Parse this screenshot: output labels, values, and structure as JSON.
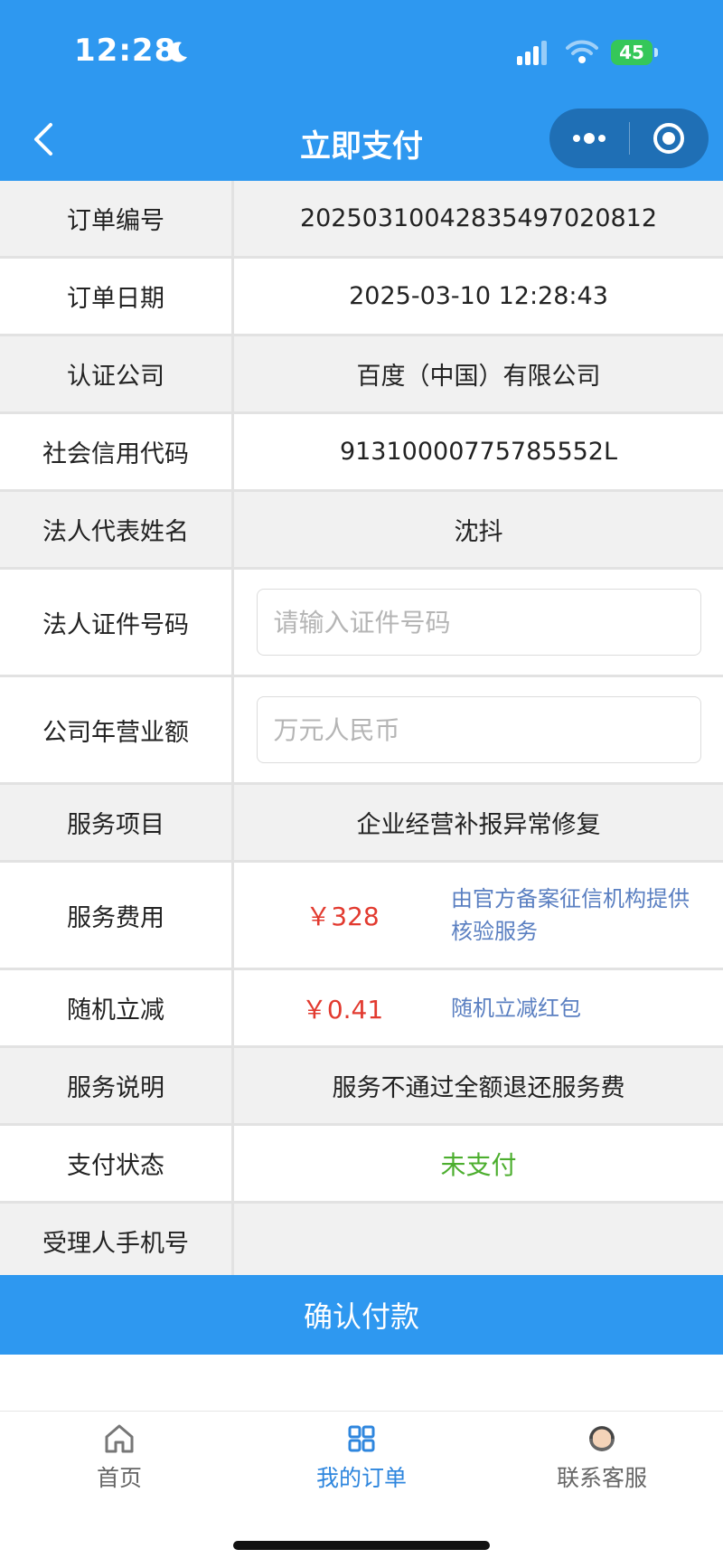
{
  "status_bar": {
    "time": "12:28",
    "battery": "45"
  },
  "nav": {
    "title": "立即支付"
  },
  "rows": [
    {
      "label": "订单编号",
      "value": "20250310042835497020812"
    },
    {
      "label": "订单日期",
      "value": "2025-03-10 12:28:43"
    },
    {
      "label": "认证公司",
      "value": "百度（中国）有限公司"
    },
    {
      "label": "社会信用代码",
      "value": "91310000775785552L"
    },
    {
      "label": "法人代表姓名",
      "value": "沈抖"
    },
    {
      "label": "法人证件号码",
      "placeholder": "请输入证件号码",
      "value": ""
    },
    {
      "label": "公司年营业额",
      "placeholder": "万元人民币",
      "value": ""
    },
    {
      "label": "服务项目",
      "value": "企业经营补报异常修复"
    },
    {
      "label": "服务费用",
      "price": "￥328",
      "note": "由官方备案征信机构提供核验服务"
    },
    {
      "label": "随机立减",
      "price": "￥0.41",
      "note": "随机立减红包"
    },
    {
      "label": "服务说明",
      "value": "服务不通过全额退还服务费"
    },
    {
      "label": "支付状态",
      "value": "未支付"
    },
    {
      "label": "受理人手机号",
      "value": ""
    }
  ],
  "confirm_label": "确认付款",
  "tabs": [
    {
      "label": "首页",
      "icon": "home-icon"
    },
    {
      "label": "我的订单",
      "icon": "grid-icon",
      "active": true
    },
    {
      "label": "联系客服",
      "icon": "customer-service-icon"
    }
  ],
  "colors": {
    "primary": "#2e98f0",
    "price": "#e23a2f",
    "note": "#5a7fc1",
    "status": "#4cae2e"
  }
}
